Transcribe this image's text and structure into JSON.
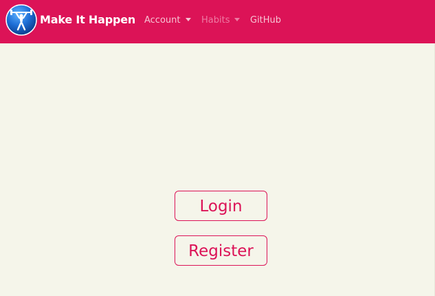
{
  "app": {
    "brand": "Make It Happen",
    "logo_icon": "weightlifter-icon"
  },
  "nav": {
    "items": [
      {
        "label": "Account",
        "dropdown": true
      },
      {
        "label": "Habits",
        "dropdown": true
      },
      {
        "label": "GitHub",
        "dropdown": false
      }
    ]
  },
  "main": {
    "login_label": "Login",
    "register_label": "Register"
  },
  "colors": {
    "primary": "#dc1357",
    "background": "#f5f5ea",
    "nav_text": "#f6c3d3",
    "nav_text_muted": "#ee7aa3"
  }
}
